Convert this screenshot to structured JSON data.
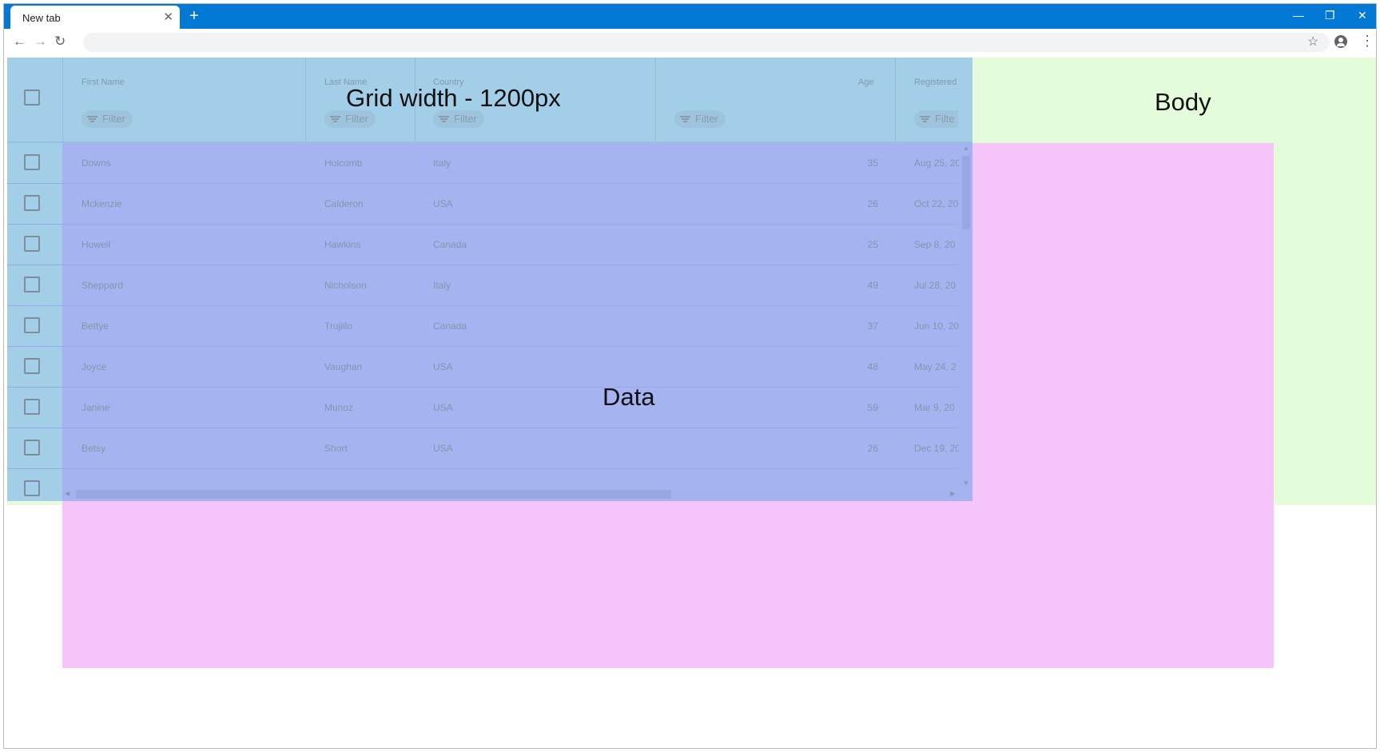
{
  "browser": {
    "tab_title": "New tab",
    "tab_close": "✕",
    "new_tab": "+",
    "minimize": "—",
    "restore": "❐",
    "close": "✕",
    "back": "←",
    "forward": "→",
    "reload": "↻",
    "address_value": "",
    "star": "☆",
    "menu": "⋮"
  },
  "labels": {
    "grid": "Grid width - 1200px",
    "body": "Body",
    "data": "Data"
  },
  "colors": {
    "titlebar": "#0078d4",
    "body_region": "#e4fcd9",
    "data_region": "#f4c4fb",
    "grid_region": "#a2cee8",
    "grid_data_overlap": "#a5b4f1"
  },
  "grid": {
    "columns": [
      "First Name",
      "Last Name",
      "Country",
      "Age",
      "Registered"
    ],
    "filter_label": "Filter",
    "filter_truncated": "Filte",
    "rows": [
      {
        "first": "Downs",
        "last": "Holcomb",
        "country": "Italy",
        "age": "35",
        "registered": "Aug 25, 20"
      },
      {
        "first": "Mckenzie",
        "last": "Calderon",
        "country": "USA",
        "age": "26",
        "registered": "Oct 22, 20"
      },
      {
        "first": "Howell",
        "last": "Hawkins",
        "country": "Canada",
        "age": "25",
        "registered": "Sep 8, 20"
      },
      {
        "first": "Sheppard",
        "last": "Nicholson",
        "country": "Italy",
        "age": "49",
        "registered": "Jul 28, 20"
      },
      {
        "first": "Bettye",
        "last": "Trujillo",
        "country": "Canada",
        "age": "37",
        "registered": "Jun 10, 20"
      },
      {
        "first": "Joyce",
        "last": "Vaughan",
        "country": "USA",
        "age": "48",
        "registered": "May 24, 2"
      },
      {
        "first": "Janine",
        "last": "Munoz",
        "country": "USA",
        "age": "59",
        "registered": "Mar 9, 20"
      },
      {
        "first": "Betsy",
        "last": "Short",
        "country": "USA",
        "age": "26",
        "registered": "Dec 19, 20"
      }
    ]
  }
}
